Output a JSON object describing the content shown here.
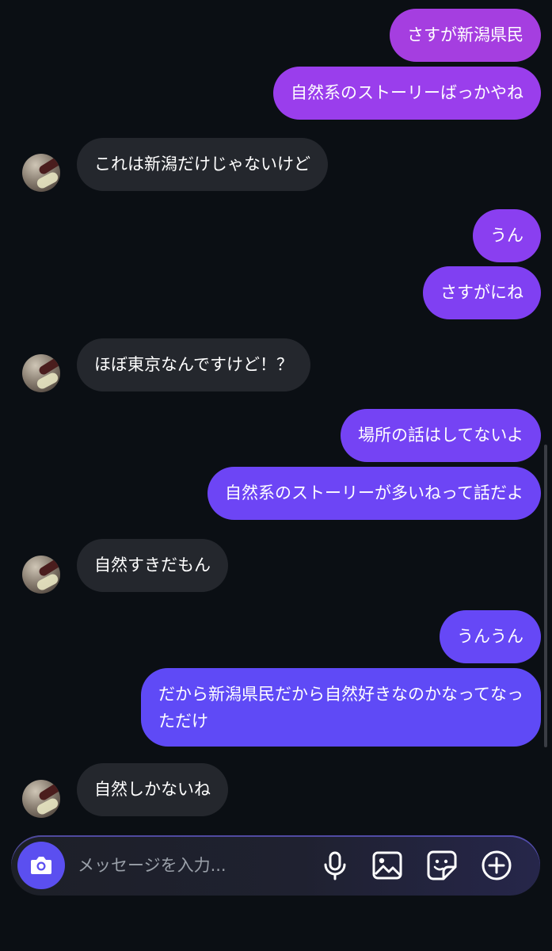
{
  "messages": [
    {
      "direction": "outgoing",
      "text": "さすが新潟県民",
      "color": "#a53ee0"
    },
    {
      "direction": "outgoing",
      "text": "自然系のストーリーばっかやね",
      "color": "#9a3eec"
    },
    {
      "direction": "incoming",
      "text": "これは新潟だけじゃないけど",
      "color": "#24272d"
    },
    {
      "direction": "outgoing",
      "text": "うん",
      "color": "#8a3ff0"
    },
    {
      "direction": "outgoing",
      "text": "さすがにね",
      "color": "#8040f2"
    },
    {
      "direction": "incoming",
      "text": "ほぼ東京なんですけど！？",
      "color": "#24272d"
    },
    {
      "direction": "outgoing",
      "text": "場所の話はしてないよ",
      "color": "#7543f4"
    },
    {
      "direction": "outgoing",
      "text": "自然系のストーリーが多いねって話だよ",
      "color": "#6d45f5"
    },
    {
      "direction": "incoming",
      "text": "自然すきだもん",
      "color": "#24272d"
    },
    {
      "direction": "outgoing",
      "text": "うんうん",
      "color": "#6648f6"
    },
    {
      "direction": "outgoing",
      "text": "だから新潟県民だから自然好きなのかなってなっただけ",
      "color": "#5f4af6"
    },
    {
      "direction": "incoming",
      "text": "自然しかないね",
      "color": "#24272d"
    }
  ],
  "composer": {
    "placeholder": "メッセージを入力...",
    "buttons": [
      {
        "name": "camera",
        "icon": "camera-icon"
      },
      {
        "name": "voice",
        "icon": "microphone-icon"
      },
      {
        "name": "gallery",
        "icon": "image-icon"
      },
      {
        "name": "sticker",
        "icon": "sticker-icon"
      },
      {
        "name": "more",
        "icon": "plus-circle-icon"
      }
    ]
  },
  "colors": {
    "background": "#0b0f14",
    "incoming_bubble": "#24272d",
    "accent": "#5b4ff0"
  }
}
